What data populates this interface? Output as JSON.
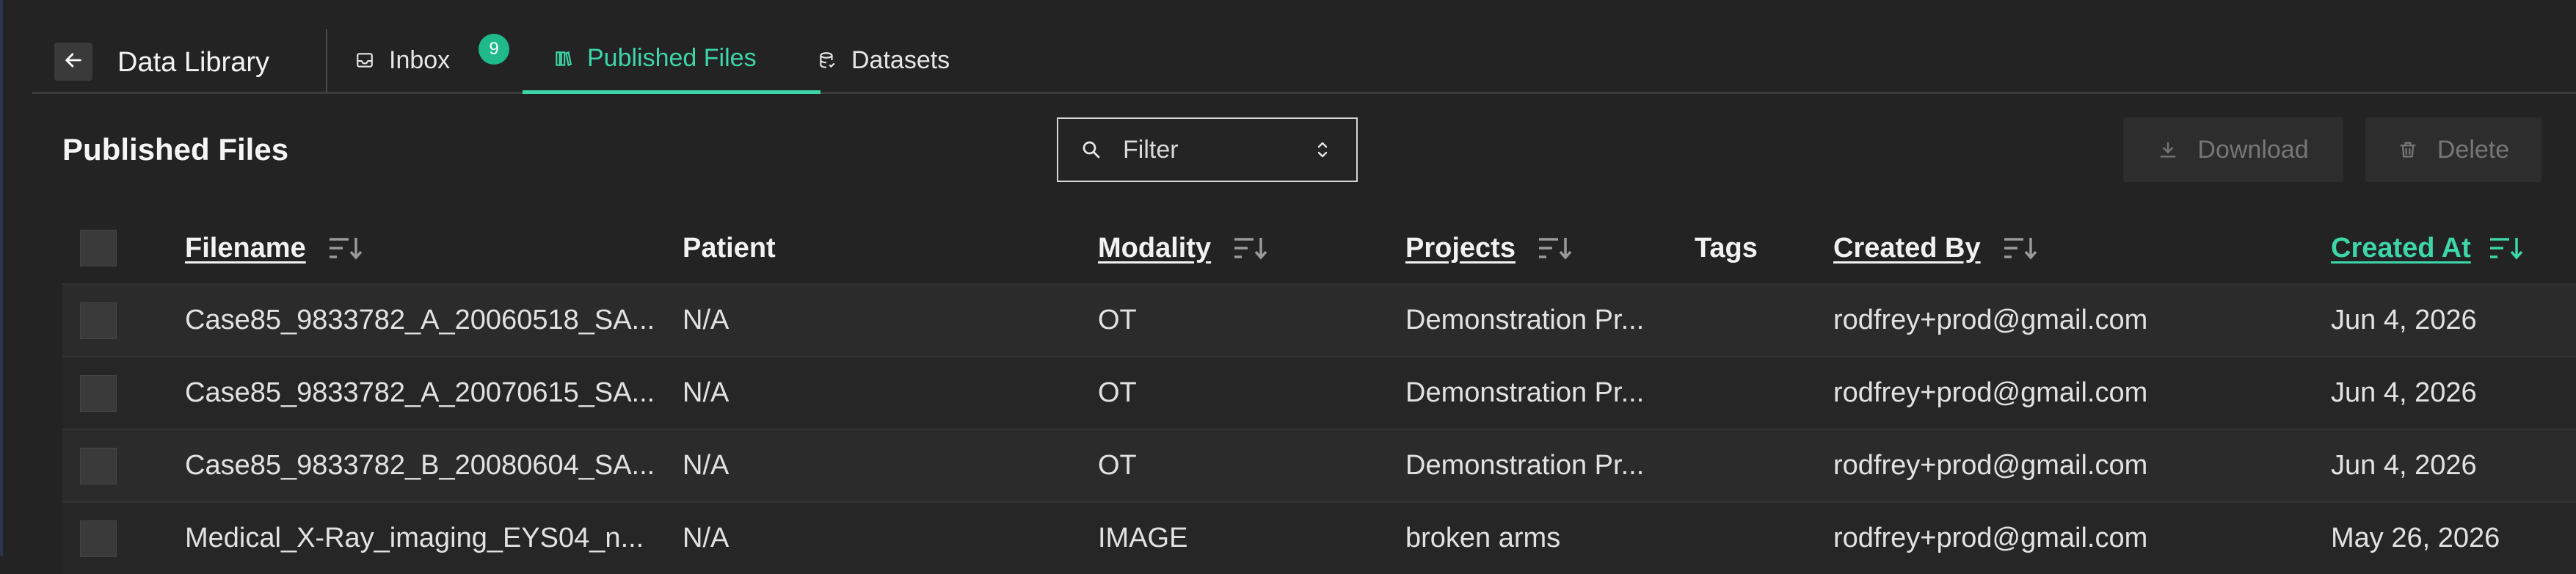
{
  "app": {
    "title": "Data Library"
  },
  "nav": {
    "tabs": [
      {
        "label": "Inbox",
        "icon": "inbox-icon",
        "badge": "9",
        "active": false
      },
      {
        "label": "Published Files",
        "icon": "books-icon",
        "active": true
      },
      {
        "label": "Datasets",
        "icon": "database-icon",
        "active": false
      }
    ]
  },
  "page": {
    "title": "Published Files"
  },
  "filter": {
    "label": "Filter"
  },
  "actions": {
    "download_label": "Download",
    "delete_label": "Delete"
  },
  "colors": {
    "accent": "#3dd6a7",
    "badge": "#1fb98a",
    "background": "#232323"
  },
  "table": {
    "columns": [
      {
        "label": "Filename",
        "sortable": true
      },
      {
        "label": "Patient",
        "sortable": false
      },
      {
        "label": "Modality",
        "sortable": true
      },
      {
        "label": "Projects",
        "sortable": true
      },
      {
        "label": "Tags",
        "sortable": false
      },
      {
        "label": "Created By",
        "sortable": true
      },
      {
        "label": "Created At",
        "sortable": true,
        "active": true
      }
    ],
    "rows": [
      {
        "filename": "Case85_9833782_A_20060518_SA...",
        "patient": "N/A",
        "modality": "OT",
        "projects": "Demonstration Pr...",
        "tags": "",
        "created_by": "rodfrey+prod@gmail.com",
        "created_at": "Jun 4, 2026"
      },
      {
        "filename": "Case85_9833782_A_20070615_SA...",
        "patient": "N/A",
        "modality": "OT",
        "projects": "Demonstration Pr...",
        "tags": "",
        "created_by": "rodfrey+prod@gmail.com",
        "created_at": "Jun 4, 2026"
      },
      {
        "filename": "Case85_9833782_B_20080604_SA...",
        "patient": "N/A",
        "modality": "OT",
        "projects": "Demonstration Pr...",
        "tags": "",
        "created_by": "rodfrey+prod@gmail.com",
        "created_at": "Jun 4, 2026"
      },
      {
        "filename": "Medical_X-Ray_imaging_EYS04_n...",
        "patient": "N/A",
        "modality": "IMAGE",
        "projects": "broken arms",
        "tags": "",
        "created_by": "rodfrey+prod@gmail.com",
        "created_at": "May 26, 2026"
      }
    ]
  }
}
